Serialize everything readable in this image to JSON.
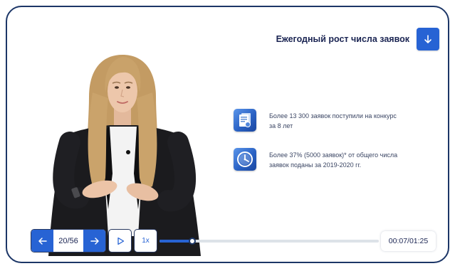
{
  "header": {
    "title": "Ежегодный рост числа заявок",
    "action_icon": "arrow-down-icon"
  },
  "facts": [
    {
      "icon": "document-icon",
      "lines": [
        "Более 13 300 заявок поступили на конкурс",
        "за 8 лет"
      ]
    },
    {
      "icon": "clock-icon",
      "lines": [
        "Более 37% (5000 заявок)* от общего числа",
        "заявок поданы за 2019-2020 гг."
      ]
    }
  ],
  "player": {
    "prev_icon": "arrow-left-icon",
    "slide_counter": "20/56",
    "next_icon": "arrow-right-icon",
    "play_icon": "play-icon",
    "speed_label": "1x",
    "progress_fraction": 0.15,
    "time_display": "00:07/01:25"
  },
  "colors": {
    "frame_border": "#1c3667",
    "accent_blue": "#2763d4",
    "title_text": "#1a2452",
    "body_text": "#3b4664",
    "progress_track": "#dde2e8"
  }
}
